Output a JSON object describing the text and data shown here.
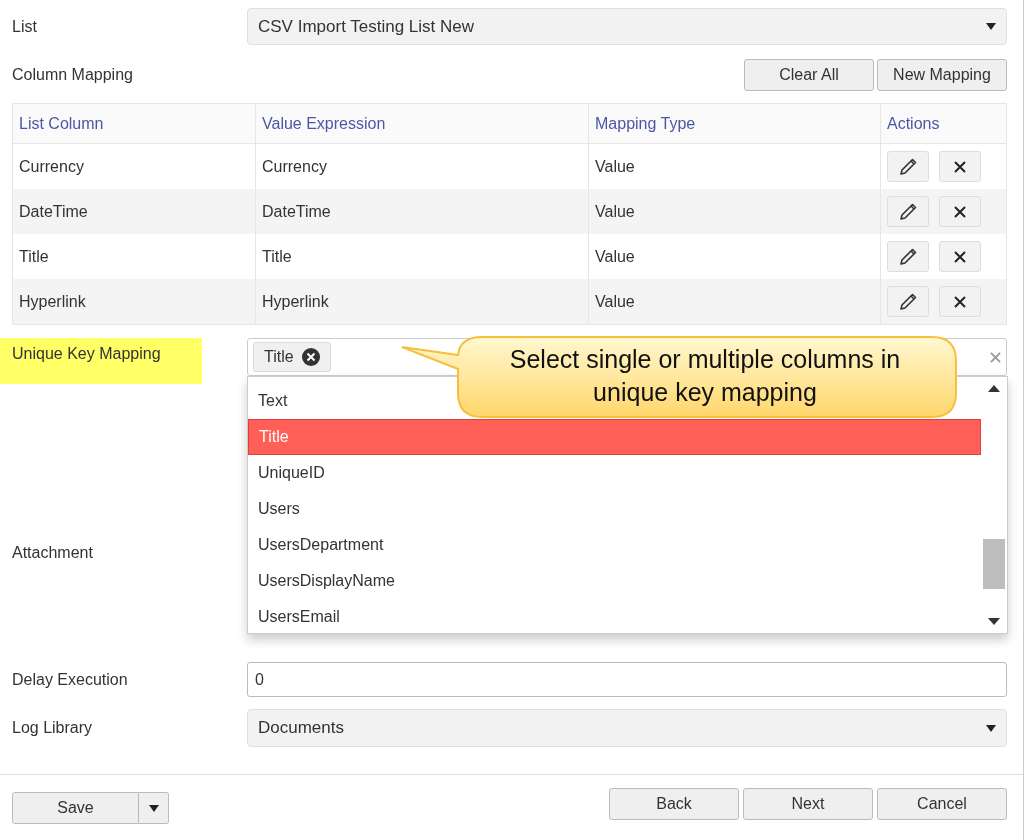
{
  "list": {
    "label": "List",
    "value": "CSV Import Testing List New"
  },
  "column_mapping": {
    "label": "Column Mapping",
    "buttons": [
      "Clear All",
      "New Mapping"
    ]
  },
  "table": {
    "columns": [
      "List Column",
      "Value Expression",
      "Mapping Type",
      "Actions"
    ],
    "rows": [
      {
        "cells": [
          "Currency",
          "Currency",
          "Value"
        ]
      },
      {
        "cells": [
          "DateTime",
          "DateTime",
          "Value"
        ]
      },
      {
        "cells": [
          "Title",
          "Title",
          "Value"
        ]
      },
      {
        "cells": [
          "Hyperlink",
          "Hyperlink",
          "Value"
        ]
      }
    ]
  },
  "unique_key": {
    "label": "Unique Key Mapping",
    "highlighted": true,
    "tags": [
      "Title"
    ],
    "dropdown": [
      {
        "label": "Text",
        "selected": false
      },
      {
        "label": "Title",
        "selected": true
      },
      {
        "label": "UniqueID",
        "selected": false
      },
      {
        "label": "Users",
        "selected": false
      },
      {
        "label": "UsersDepartment",
        "selected": false
      },
      {
        "label": "UsersDisplayName",
        "selected": false
      },
      {
        "label": "UsersEmail",
        "selected": false
      }
    ]
  },
  "callout": {
    "text": "Select single or multiple columns in unique key mapping"
  },
  "attachment": {
    "label": "Attachment"
  },
  "delay_execution": {
    "label": "Delay Execution",
    "value": "0"
  },
  "log_library": {
    "label": "Log Library",
    "value": "Documents"
  },
  "footer": {
    "save": "Save",
    "buttons": [
      "Back",
      "Next",
      "Cancel"
    ]
  }
}
